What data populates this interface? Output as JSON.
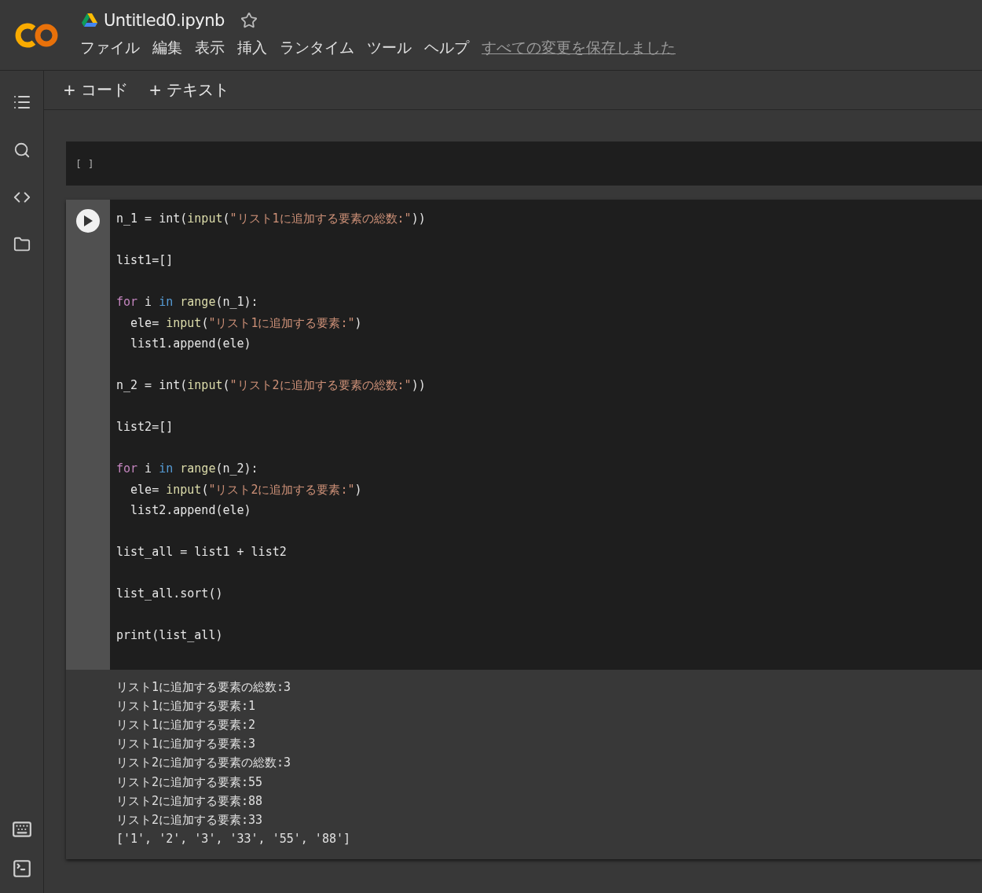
{
  "header": {
    "file_name": "Untitled0.ipynb",
    "starred": false,
    "menu": [
      "ファイル",
      "編集",
      "表示",
      "挿入",
      "ランタイム",
      "ツール",
      "ヘルプ"
    ],
    "save_status": "すべての変更を保存しました"
  },
  "toolbar": {
    "buttons": [
      "+ コード",
      "+ テキスト"
    ]
  },
  "cells": [
    {
      "kind": "empty",
      "prompt": "[ ]"
    },
    {
      "kind": "code",
      "blocks": [
        [
          [
            {
              "kind": "plain",
              "text": "n_1 = int("
            },
            {
              "kind": "builtin",
              "text": "input"
            },
            {
              "kind": "plain",
              "text": "("
            },
            {
              "kind": "string",
              "text": "\"リスト1に追加する要素の総数:\""
            },
            {
              "kind": "plain",
              "text": "))"
            }
          ]
        ],
        [
          [
            {
              "kind": "plain",
              "text": "list1=[]"
            }
          ]
        ],
        [
          [
            {
              "kind": "control",
              "text": "for"
            },
            {
              "kind": "plain",
              "text": " i "
            },
            {
              "kind": "keyword",
              "text": "in "
            },
            {
              "kind": "builtin",
              "text": "range"
            },
            {
              "kind": "plain",
              "text": "(n_1):"
            }
          ],
          [
            {
              "kind": "plain",
              "text": "  ele= "
            },
            {
              "kind": "builtin",
              "text": "input"
            },
            {
              "kind": "plain",
              "text": "("
            },
            {
              "kind": "string",
              "text": "\"リスト1に追加する要素:\""
            },
            {
              "kind": "plain",
              "text": ")"
            }
          ],
          [
            {
              "kind": "plain",
              "text": "  list1.append(ele)"
            }
          ]
        ],
        [
          [
            {
              "kind": "plain",
              "text": "n_2 = int("
            },
            {
              "kind": "builtin",
              "text": "input"
            },
            {
              "kind": "plain",
              "text": "("
            },
            {
              "kind": "string",
              "text": "\"リスト2に追加する要素の総数:\""
            },
            {
              "kind": "plain",
              "text": "))"
            }
          ]
        ],
        [
          [
            {
              "kind": "plain",
              "text": "list2=[]"
            }
          ]
        ],
        [
          [
            {
              "kind": "control",
              "text": "for"
            },
            {
              "kind": "plain",
              "text": " i "
            },
            {
              "kind": "keyword",
              "text": "in "
            },
            {
              "kind": "builtin",
              "text": "range"
            },
            {
              "kind": "plain",
              "text": "(n_2):"
            }
          ],
          [
            {
              "kind": "plain",
              "text": "  ele= "
            },
            {
              "kind": "builtin",
              "text": "input"
            },
            {
              "kind": "plain",
              "text": "("
            },
            {
              "kind": "string",
              "text": "\"リスト2に追加する要素:\""
            },
            {
              "kind": "plain",
              "text": ")"
            }
          ],
          [
            {
              "kind": "plain",
              "text": "  list2.append(ele)"
            }
          ]
        ],
        [
          [
            {
              "kind": "plain",
              "text": "list_all = list1 + list2"
            }
          ]
        ],
        [
          [
            {
              "kind": "plain",
              "text": "list_all.sort()"
            }
          ]
        ],
        [
          [
            {
              "kind": "plain",
              "text": "print(list_all)"
            }
          ]
        ]
      ],
      "output": [
        "リスト1に追加する要素の総数:3",
        "リスト1に追加する要素:1",
        "リスト1に追加する要素:2",
        "リスト1に追加する要素:3",
        "リスト2に追加する要素の総数:3",
        "リスト2に追加する要素:55",
        "リスト2に追加する要素:88",
        "リスト2に追加する要素:33",
        "['1', '2', '3', '33', '55', '88']"
      ]
    }
  ]
}
